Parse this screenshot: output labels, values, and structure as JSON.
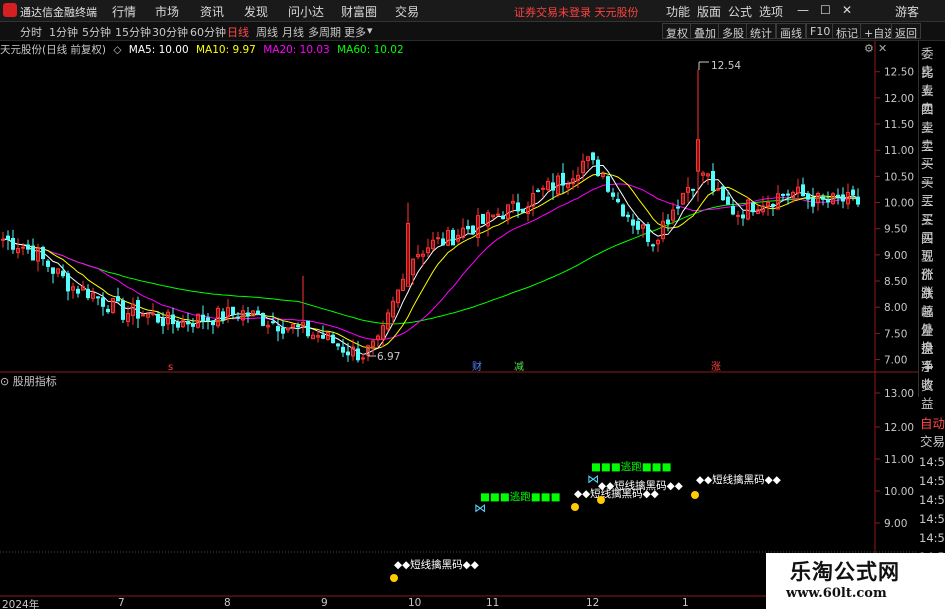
{
  "menubar": {
    "app_name": "通达信金融终端",
    "items": [
      "行情",
      "市场",
      "资讯",
      "发现",
      "问小达",
      "财富圈",
      "交易"
    ],
    "status": "证券交易未登录   天元股份",
    "right_items": [
      "功能",
      "版面",
      "公式",
      "选项"
    ],
    "guest": "游客"
  },
  "toolbar": {
    "periods": [
      "分时",
      "1分钟",
      "5分钟",
      "15分钟",
      "30分钟",
      "60分钟",
      "日线",
      "周线",
      "月线",
      "多周期",
      "更多"
    ],
    "active_period": "日线",
    "right_buttons": [
      "复权",
      "叠加",
      "多股",
      "统计",
      "画线",
      "F10",
      "标记",
      "+自选",
      "返回"
    ]
  },
  "main_chart": {
    "title": "天元股份(日线 前复权)",
    "ma5": "MA5: 10.00",
    "ma10": "MA10: 9.97",
    "ma20": "MA20: 10.03",
    "ma60": "MA60: 10.02",
    "high_label": "12.54",
    "low_label": "6.97",
    "markers": {
      "s": "s",
      "cai": "财",
      "jian": "减",
      "zhang": "涨"
    },
    "colors": {
      "up": "#ff3232",
      "down": "#54fcfc",
      "ma5": "#ffffff",
      "ma10": "#ffff00",
      "ma20": "#ff00ff",
      "ma60": "#00ff00"
    }
  },
  "indicator": {
    "title": "股朋指标",
    "signals": {
      "escape": "■■■逃跑■■■",
      "sdhm": "◆◆短线擒黑码◆◆"
    }
  },
  "right_panel": {
    "items": [
      "委比",
      "卖五",
      "卖四",
      "卖三",
      "卖二",
      "卖一",
      "买一",
      "买二",
      "买三",
      "买四",
      "买五",
      "现价",
      "涨跌",
      "涨幅",
      "总量",
      "外盘",
      "换手",
      "净资",
      "收益"
    ],
    "items2": [
      "自动",
      "交易"
    ],
    "times": [
      "14:5",
      "14:5",
      "14:5",
      "14:5",
      "14:5",
      "14:5",
      "14:5",
      "14:5"
    ]
  },
  "watermark": {
    "name": "乐淘公式网",
    "url": "www.60lt.com"
  },
  "chart_data": {
    "type": "candlestick",
    "title": "天元股份(日线 前复权)",
    "price_axis": [
      12.5,
      12.0,
      11.5,
      11.0,
      10.5,
      10.0,
      9.5,
      9.0,
      8.5,
      8.0,
      7.5,
      7.0
    ],
    "ylim": [
      6.8,
      12.8
    ],
    "indicator_axis": [
      "13.00",
      "12.00",
      "11.00",
      "10.00",
      "9.00"
    ],
    "date_labels": [
      "2024年",
      "7",
      "8",
      "9",
      "10",
      "11",
      "12",
      "1"
    ],
    "annotations": {
      "high": 12.54,
      "low": 6.97
    },
    "ma": {
      "MA5": 10.0,
      "MA10": 9.97,
      "MA20": 10.03,
      "MA60": 10.02
    },
    "key_prices": [
      9.3,
      9.2,
      9.0,
      8.7,
      8.4,
      8.3,
      8.1,
      7.9,
      7.9,
      7.8,
      7.7,
      7.75,
      7.8,
      7.85,
      7.9,
      7.8,
      7.7,
      7.6,
      7.5,
      7.4,
      7.2,
      7.1,
      7.3,
      8.2,
      9.0,
      9.2,
      9.3,
      9.5,
      9.6,
      9.8,
      9.9,
      10.1,
      10.3,
      10.5,
      10.8,
      10.6,
      10.0,
      9.6,
      9.3,
      9.8,
      10.3,
      10.6,
      10.0,
      9.8,
      10.0,
      10.1,
      10.2,
      10.1,
      10.0,
      10.05,
      10.0
    ]
  }
}
